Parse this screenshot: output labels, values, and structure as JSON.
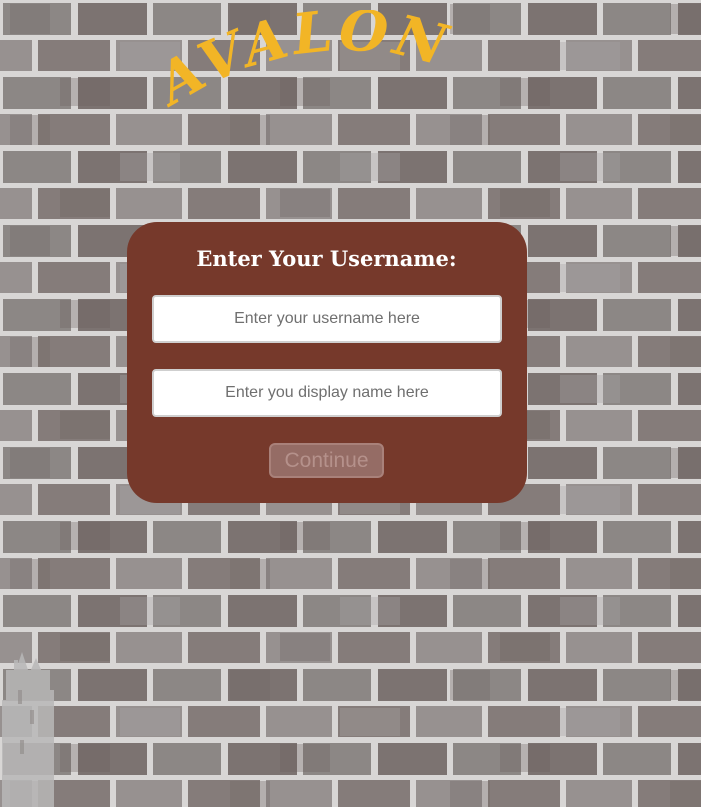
{
  "brand": {
    "logo_text": "AVALON",
    "logo_color": "#f2b526"
  },
  "colors": {
    "panel_bg": "#76392b",
    "button_bg": "#956c65",
    "button_text": "#b5918b",
    "wall_mortar": "#d8d6d5"
  },
  "login": {
    "title": "Enter Your Username:",
    "username_placeholder": "Enter your username here",
    "username_value": "",
    "display_placeholder": "Enter you display name here",
    "display_value": "",
    "continue_label": "Continue",
    "continue_state": "disabled"
  },
  "decor": {
    "background": "brick-wall",
    "corner_image": "castle-tower-silhouette"
  }
}
